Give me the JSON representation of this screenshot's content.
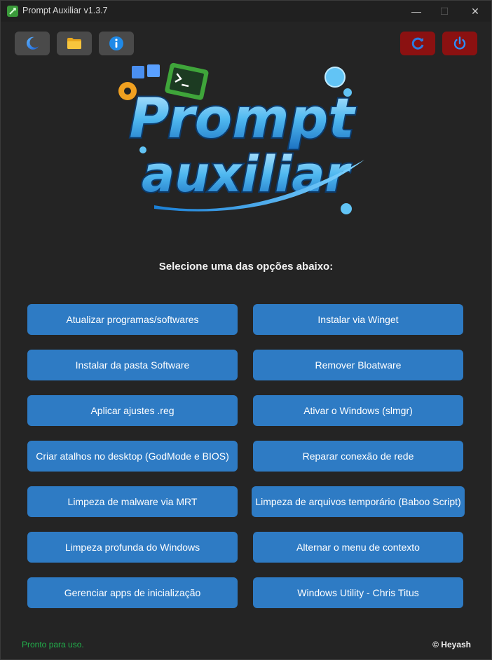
{
  "window": {
    "title": "Prompt Auxiliar v1.3.7",
    "minimize_glyph": "—",
    "maximize_glyph": "☐",
    "close_glyph": "✕"
  },
  "toolbar": {
    "theme_icon": "moon-icon",
    "folder_icon": "folder-icon",
    "info_icon": "info-icon",
    "refresh_icon": "refresh-icon",
    "power_icon": "power-icon"
  },
  "logo": {
    "line1": "Prompt",
    "line2": "auxiliar"
  },
  "heading": "Selecione uma das opções abaixo:",
  "options": {
    "left": [
      "Atualizar programas/softwares",
      "Instalar da pasta Software",
      "Aplicar ajustes .reg",
      "Criar atalhos no desktop (GodMode e BIOS)",
      "Limpeza de malware via MRT",
      "Limpeza profunda do Windows",
      "Gerenciar apps de inicialização"
    ],
    "right": [
      "Instalar via Winget",
      "Remover Bloatware",
      "Ativar o Windows (slmgr)",
      "Reparar conexão de rede",
      "Limpeza de arquivos temporário (Baboo Script)",
      "Alternar o menu de contexto",
      "Windows Utility - Chris Titus"
    ]
  },
  "footer": {
    "status": "Pronto para uso.",
    "credit": "© Heyash"
  },
  "colors": {
    "background": "#242424",
    "button_blue": "#2e7bc4",
    "toolbar_gray": "#4a4a4a",
    "toolbar_red": "#8b1111",
    "status_green": "#22b14c"
  }
}
